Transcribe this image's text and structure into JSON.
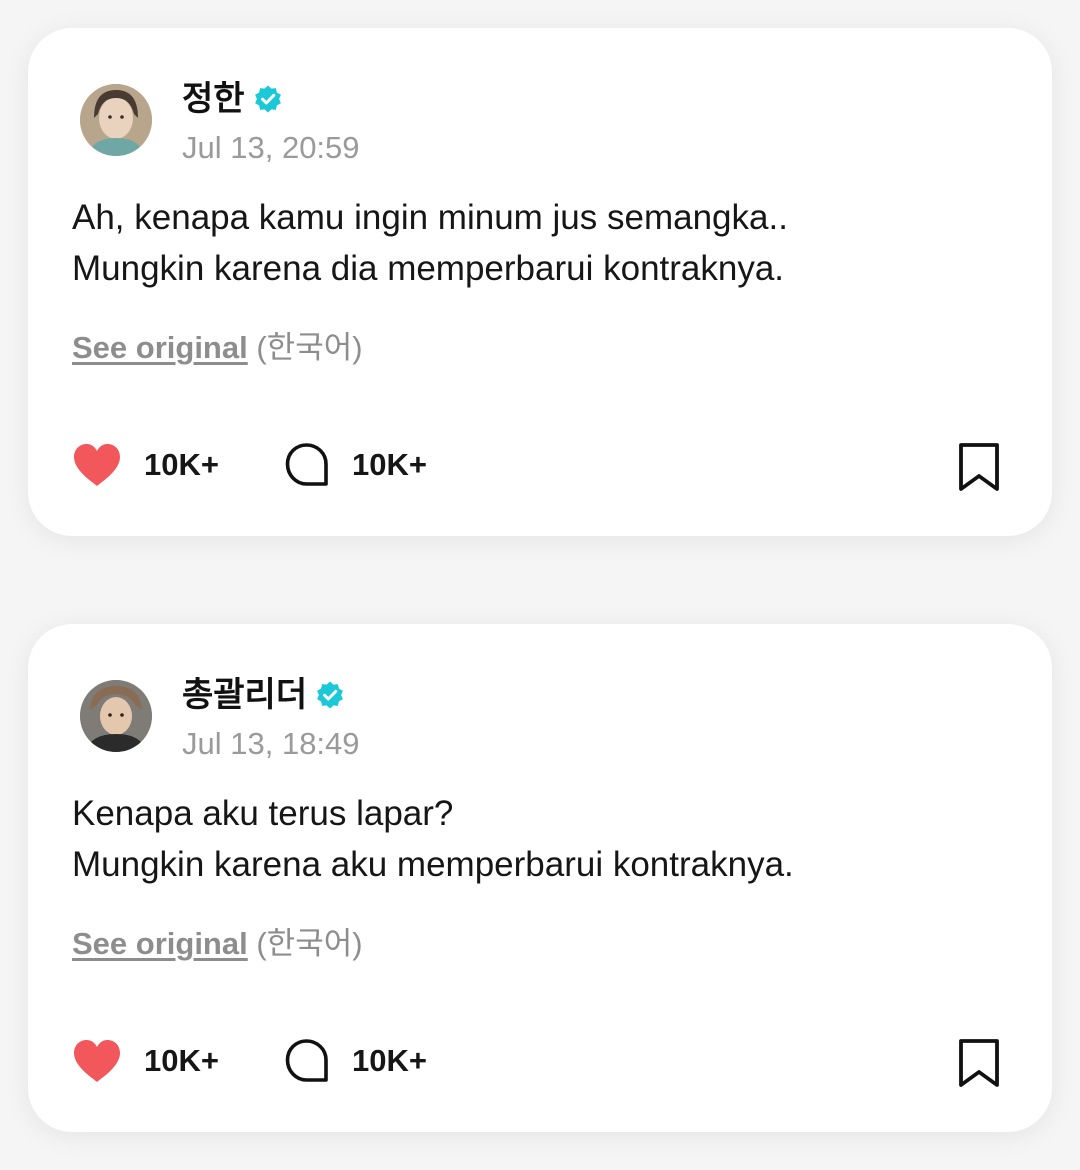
{
  "colors": {
    "background": "#f5f5f5",
    "card": "#ffffff",
    "verified_badge": "#1bc8d8",
    "like_heart": "#f2575b",
    "muted_text": "#9a9a9a"
  },
  "posts": [
    {
      "author": "정한",
      "verified": true,
      "timestamp": "Jul 13, 20:59",
      "body_lines": [
        "Ah, kenapa kamu ingin minum jus semangka..",
        "Mungkin karena dia memperbarui kontraknya."
      ],
      "see_original_label": "See original",
      "original_language": "(한국어)",
      "likes": "10K+",
      "comments": "10K+",
      "icons": {
        "avatar": "avatar",
        "verified": "verified-badge-icon",
        "like": "heart-icon",
        "comment": "comment-bubble-icon",
        "bookmark": "bookmark-icon"
      }
    },
    {
      "author": "총괄리더",
      "verified": true,
      "timestamp": "Jul 13, 18:49",
      "body_lines": [
        "Kenapa aku terus lapar?",
        "Mungkin karena aku memperbarui kontraknya."
      ],
      "see_original_label": "See original",
      "original_language": "(한국어)",
      "likes": "10K+",
      "comments": "10K+",
      "icons": {
        "avatar": "avatar",
        "verified": "verified-badge-icon",
        "like": "heart-icon",
        "comment": "comment-bubble-icon",
        "bookmark": "bookmark-icon"
      }
    }
  ]
}
